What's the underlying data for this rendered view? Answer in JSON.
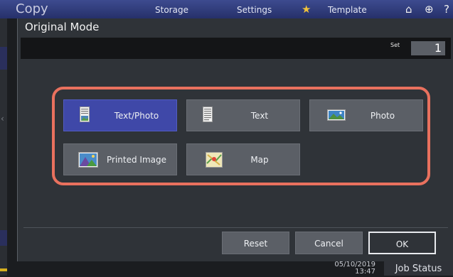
{
  "app": {
    "title": "Copy",
    "tabs": [
      "Storage",
      "Settings",
      "Template"
    ]
  },
  "dialog": {
    "title": "Original Mode",
    "set_label": "Set",
    "set_value": "1"
  },
  "modes": [
    {
      "label": "Text/Photo",
      "icon": "text-photo-icon",
      "selected": true
    },
    {
      "label": "Text",
      "icon": "text-document-icon",
      "selected": false
    },
    {
      "label": "Photo",
      "icon": "photo-icon",
      "selected": false
    },
    {
      "label": "Printed Image",
      "icon": "printed-image-icon",
      "selected": false
    },
    {
      "label": "Map",
      "icon": "map-icon",
      "selected": false
    }
  ],
  "actions": {
    "reset": "Reset",
    "cancel": "Cancel",
    "ok": "OK"
  },
  "status": {
    "date": "05/10/2019",
    "time": "13:47",
    "job_status": "Job Status"
  },
  "colors": {
    "selected": "#3f48a8",
    "button": "#5b5f66",
    "highlight_frame": "#e9715e"
  }
}
